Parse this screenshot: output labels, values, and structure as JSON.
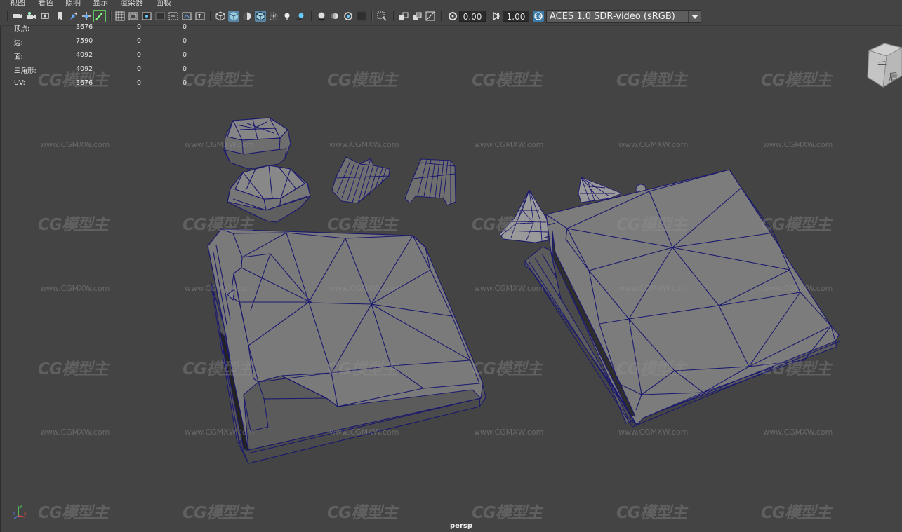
{
  "menubar": {
    "items": [
      "视图",
      "着色",
      "照明",
      "显示",
      "渲染器",
      "面板"
    ]
  },
  "toolbar": {
    "gamma_value": "0.00",
    "exposure_value": "1.00",
    "color_space": "ACES 1.0 SDR-video (sRGB)",
    "icons": [
      "camera-select-icon",
      "camera-attributes-icon",
      "bookmark-icon",
      "image-plane-icon",
      "grease-pencil-icon",
      "two-d-pan-icon",
      "grid-icon",
      "film-gate-icon",
      "resolution-gate-icon",
      "gate-mask-icon",
      "field-chart-icon",
      "safe-action-icon",
      "safe-title-icon",
      "wireframe-icon",
      "smooth-shade-icon",
      "default-material-icon",
      "wireframe-on-shaded-icon",
      "xray-icon",
      "use-lights-icon",
      "shadows-icon",
      "screen-space-ao-icon",
      "motion-blur-icon",
      "anti-alias-icon",
      "isolate-select-icon",
      "xray-joints-icon",
      "xray-active-icon",
      "backface-icon",
      "gamma-icon",
      "exposure-icon",
      "color-management-icon"
    ]
  },
  "hud": {
    "rows": [
      {
        "label": "顶点:",
        "v1": "3676",
        "v2": "0",
        "v3": "0"
      },
      {
        "label": "边:",
        "v1": "7590",
        "v2": "0",
        "v3": "0"
      },
      {
        "label": "面:",
        "v1": "4092",
        "v2": "0",
        "v3": "0"
      },
      {
        "label": "三角形:",
        "v1": "4092",
        "v2": "0",
        "v3": "0"
      },
      {
        "label": "UV:",
        "v1": "3676",
        "v2": "0",
        "v3": "0"
      }
    ]
  },
  "viewport": {
    "camera_label": "persp",
    "view_cube_faces": [
      "千",
      "后"
    ],
    "axis_labels": [
      "y",
      "x",
      "z"
    ]
  },
  "watermark": {
    "logo_text": "CG模型主",
    "url_text": "www.CGMXW.com"
  },
  "colors": {
    "background": "#444444",
    "mesh_fill": "#7a7a7a",
    "wireframe": "#1b1a6e",
    "active_icon": "#5a87a8"
  }
}
